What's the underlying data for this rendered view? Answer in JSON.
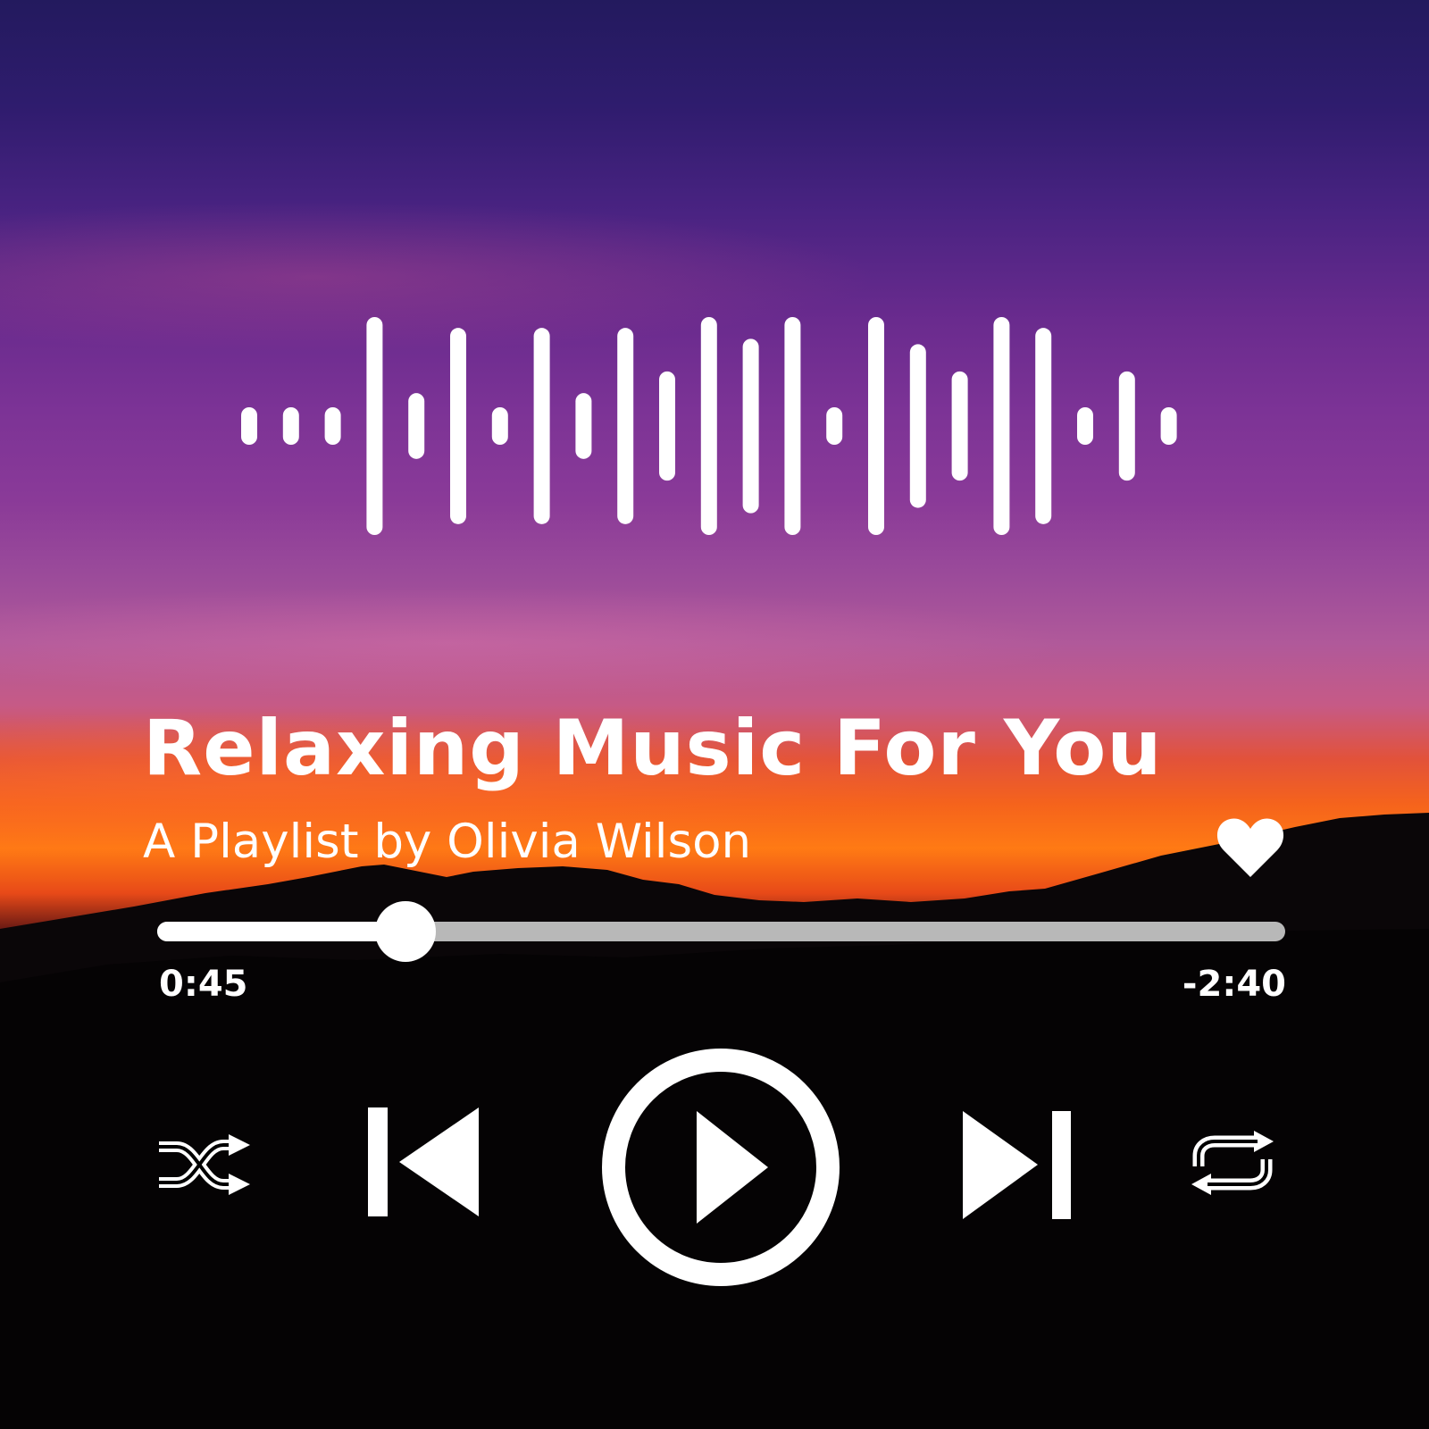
{
  "player": {
    "title": "Relaxing Music For You",
    "subtitle": "A Playlist by Olivia Wilson",
    "elapsed": "0:45",
    "remaining": "-2:40",
    "progress_fraction": 0.22,
    "liked": true
  },
  "waveform": {
    "bar_levels": [
      0.17,
      0.17,
      0.17,
      1.0,
      0.3,
      0.9,
      0.17,
      0.9,
      0.3,
      0.9,
      0.5,
      1.0,
      0.8,
      1.0,
      0.17,
      1.0,
      0.75,
      0.5,
      1.0,
      0.9,
      0.17,
      0.5,
      0.17
    ]
  },
  "controls": {
    "shuffle": "shuffle-icon",
    "previous": "skip-previous-icon",
    "play": "play-icon",
    "next": "skip-next-icon",
    "repeat": "repeat-icon"
  },
  "colors": {
    "foreground": "#ffffff",
    "track_remaining": "#b8b8b8"
  }
}
